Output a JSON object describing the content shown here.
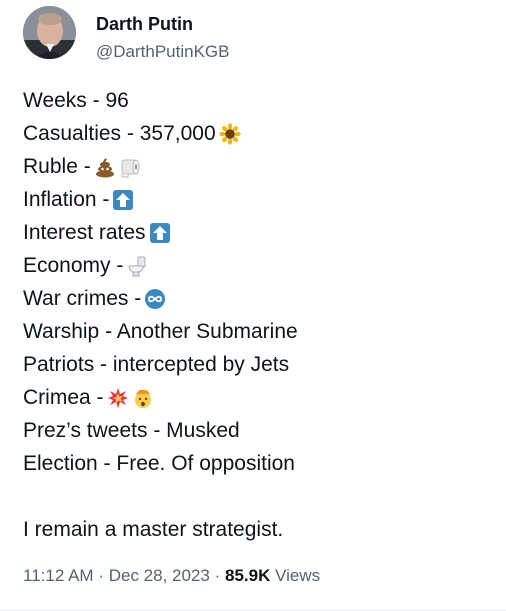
{
  "author": {
    "name": "Darth Putin",
    "handle": "@DarthPutinKGB"
  },
  "tweet": {
    "lines": [
      {
        "text": "Weeks - 96",
        "emojis": []
      },
      {
        "text": "Casualties - 357,000",
        "emojis": [
          "sunflower-icon"
        ]
      },
      {
        "text": "Ruble - ",
        "emojis": [
          "poop-icon",
          "toilet-paper-icon"
        ]
      },
      {
        "text": "Inflation - ",
        "emojis": [
          "up-arrow-icon"
        ]
      },
      {
        "text": "Interest rates ",
        "emojis": [
          "up-arrow-icon"
        ]
      },
      {
        "text": "Economy - ",
        "emojis": [
          "toilet-icon"
        ]
      },
      {
        "text": "War crimes - ",
        "emojis": [
          "infinity-icon"
        ]
      },
      {
        "text": "Warship - Another Submarine",
        "emojis": []
      },
      {
        "text": "Patriots - intercepted by Jets",
        "emojis": []
      },
      {
        "text": "Crimea - ",
        "emojis": [
          "explosion-icon",
          "exploding-head-icon"
        ]
      },
      {
        "text": "Prez’s tweets - Musked",
        "emojis": []
      },
      {
        "text": "Election - Free. Of opposition",
        "emojis": []
      }
    ],
    "closing": "I remain a master strategist."
  },
  "meta": {
    "time": "11:12 AM",
    "sep": "·",
    "date": "Dec 28, 2023",
    "views_count": "85.9K",
    "views_label": "Views"
  },
  "colors": {
    "text": "#0f1419",
    "secondary": "#536471",
    "blue_emoji": "#3b88c3"
  }
}
